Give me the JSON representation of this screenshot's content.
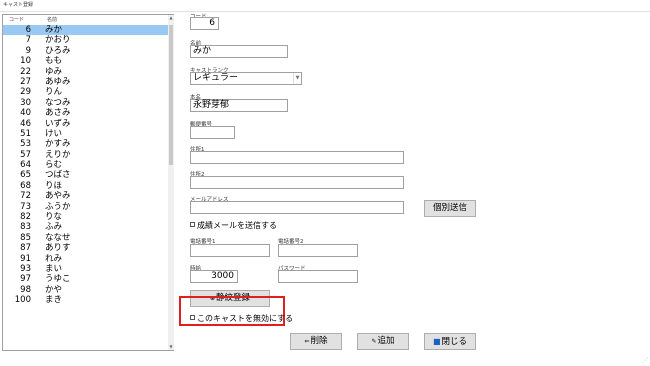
{
  "window": {
    "title": "キャスト登録"
  },
  "list": {
    "headers": {
      "code": "コード",
      "name": "名前"
    },
    "selected_index": 0,
    "rows": [
      {
        "code": "6",
        "name": "みか"
      },
      {
        "code": "7",
        "name": "かおり"
      },
      {
        "code": "9",
        "name": "ひろみ"
      },
      {
        "code": "10",
        "name": "もも"
      },
      {
        "code": "22",
        "name": "ゆみ"
      },
      {
        "code": "27",
        "name": "あゆみ"
      },
      {
        "code": "29",
        "name": "りん"
      },
      {
        "code": "30",
        "name": "なつみ"
      },
      {
        "code": "40",
        "name": "あさみ"
      },
      {
        "code": "46",
        "name": "いずみ"
      },
      {
        "code": "51",
        "name": "けい"
      },
      {
        "code": "53",
        "name": "かすみ"
      },
      {
        "code": "57",
        "name": "えりか"
      },
      {
        "code": "64",
        "name": "らむ"
      },
      {
        "code": "65",
        "name": "つばさ"
      },
      {
        "code": "68",
        "name": "りほ"
      },
      {
        "code": "72",
        "name": "あやみ"
      },
      {
        "code": "73",
        "name": "ふうか"
      },
      {
        "code": "82",
        "name": "りな"
      },
      {
        "code": "83",
        "name": "ふみ"
      },
      {
        "code": "85",
        "name": "ななせ"
      },
      {
        "code": "87",
        "name": "ありす"
      },
      {
        "code": "91",
        "name": "れみ"
      },
      {
        "code": "93",
        "name": "まい"
      },
      {
        "code": "97",
        "name": "うゆこ"
      },
      {
        "code": "98",
        "name": "かや"
      },
      {
        "code": "100",
        "name": "まき"
      }
    ]
  },
  "form": {
    "code_label": "コード",
    "code_value": "6",
    "name_label": "名前",
    "name_value": "みか",
    "rank_label": "キャストランク",
    "rank_value": "レギュラー",
    "realname_label": "本名",
    "realname_value": "永野芽郁",
    "zip_label": "郵便番号",
    "zip_value": "",
    "addr1_label": "住所1",
    "addr1_value": "",
    "addr2_label": "住所2",
    "addr2_value": "",
    "mail_label": "メールアドレス",
    "mail_value": "",
    "individual_send_label": "個別送信",
    "send_results_label": "成績メールを送信する",
    "tel1_label": "電話番号1",
    "tel1_value": "",
    "tel2_label": "電話番号2",
    "tel2_value": "",
    "hourly_label": "時給",
    "hourly_value": "3000",
    "password_label": "パスワード",
    "password_value": "",
    "fingerprint_label": "静紋登録",
    "disable_label": "このキャストを無効にする"
  },
  "footer": {
    "delete_label": "削除",
    "add_label": "追加",
    "close_label": "閉じる"
  },
  "colors": {
    "selected_row": "#99c9f3",
    "highlight_border": "#e02020",
    "close_icon": "#1f5fbf"
  }
}
